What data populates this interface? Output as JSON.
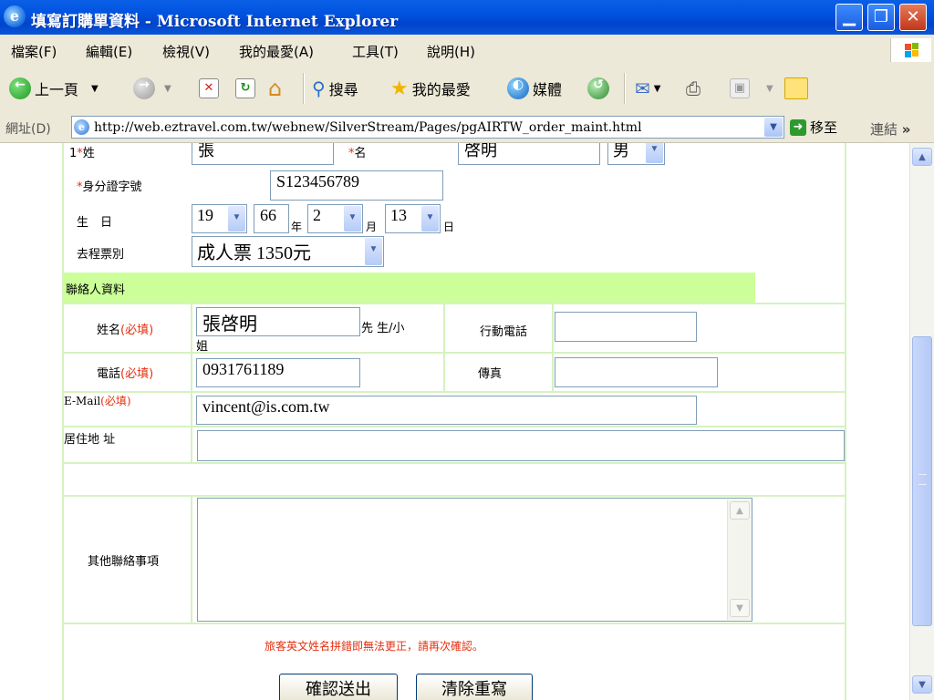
{
  "window": {
    "title": "填寫訂購單資料 - Microsoft Internet Explorer",
    "ie_icon": "e"
  },
  "menu": [
    "檔案(F)",
    "編輯(E)",
    "檢視(V)",
    "我的最愛(A)",
    "工具(T)",
    "說明(H)"
  ],
  "toolbar": {
    "back": "上一頁",
    "search": "搜尋",
    "favorites": "我的最愛",
    "media": "媒體"
  },
  "address": {
    "label": "網址(D)",
    "url": "http://web.eztravel.com.tw/webnew/SilverStream/Pages/pgAIRTW_order_maint.html",
    "go": "移至",
    "links": "連結"
  },
  "form": {
    "passenger": {
      "surname_label_prefix": "1",
      "req_mark": "*",
      "surname_label": "姓",
      "surname_value": "張",
      "given_label": "名",
      "given_value": "啓明",
      "gender_value": "男",
      "id_label": "身分證字號",
      "id_value": "S123456789",
      "birthday_label": "生　日",
      "birth_century": "19",
      "birth_year": "66",
      "year_unit": "年",
      "birth_month": "2",
      "month_unit": "月",
      "birth_day": "13",
      "day_unit": "日",
      "ticket_label": "去程票別",
      "ticket_value": "成人票 1350元"
    },
    "contact": {
      "section_title": "聯絡人資料",
      "name_label": "姓名",
      "required": "(必填)",
      "name_value": "張啓明",
      "salutation_a": "先 生/小",
      "salutation_b": "姐",
      "mobile_label": "行動電話",
      "mobile_value": "",
      "phone_label": "電話",
      "phone_value": "0931761189",
      "fax_label": "傳真",
      "fax_value": "",
      "email_label": "E-Mail",
      "email_value": "vincent@is.com.tw",
      "address_label": "居住地 址",
      "address_value": "",
      "notes_label": "其他聯絡事項",
      "notes_value": ""
    },
    "warning": "旅客英文姓名拼錯即無法更正，請再次確認。",
    "submit_label": "確認送出",
    "reset_label": "清除重寫"
  },
  "colors": {
    "section_bg": "#ccff99",
    "cell_border": "#d6f2c0",
    "required": "#e53010"
  }
}
